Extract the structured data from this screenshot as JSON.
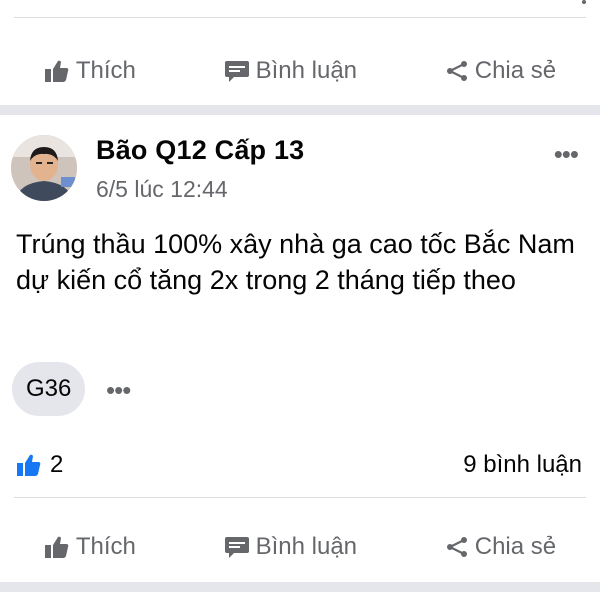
{
  "top_actions": {
    "like": "Thích",
    "comment": "Bình luận",
    "share": "Chia sẻ"
  },
  "post": {
    "author": "Bão Q12 Cấp 13",
    "timestamp": "6/5 lúc 12:44",
    "text": "Trúng thầu 100% xây nhà ga cao tốc Bắc Nam dự kiến cổ tăng 2x trong 2 tháng tiếp theo",
    "tag": "G36",
    "like_count": "2",
    "comment_count": "9 bình luận",
    "icons": [
      "more-options-icon",
      "like-reaction-icon"
    ]
  },
  "bottom_actions": {
    "like": "Thích",
    "comment": "Bình luận",
    "share": "Chia sẻ"
  },
  "colors": {
    "like_blue": "#1877f2",
    "secondary_text": "#65676b",
    "separator": "#e4e6eb"
  }
}
